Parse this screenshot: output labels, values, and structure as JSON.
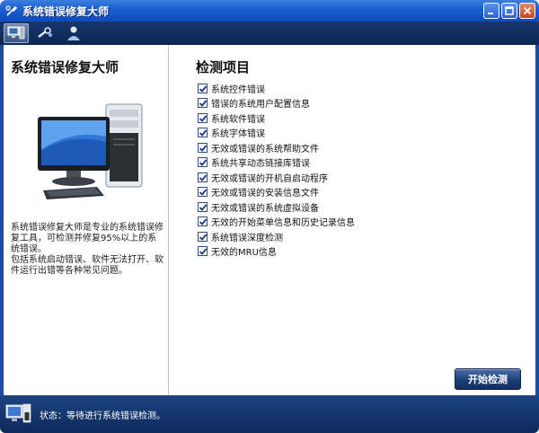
{
  "window": {
    "title": "系统错误修复大师"
  },
  "left_panel": {
    "title": "系统错误修复大师",
    "description_line1": "系统错误修复大师是专业的系统错误修复工具，可检测并修复95%以上的系统错误。",
    "description_line2": "包括系统启动错误、软件无法打开、软件运行出错等各种常见问题。"
  },
  "right_panel": {
    "title": "检测项目",
    "items": [
      {
        "label": "系统控件错误",
        "checked": true
      },
      {
        "label": "错误的系统用户配置信息",
        "checked": true
      },
      {
        "label": "系统软件错误",
        "checked": true
      },
      {
        "label": "系统字体错误",
        "checked": true
      },
      {
        "label": "无效或错误的系统帮助文件",
        "checked": true
      },
      {
        "label": "系统共享动态链接库错误",
        "checked": true
      },
      {
        "label": "无效或错误的开机自启动程序",
        "checked": true
      },
      {
        "label": "无效或错误的安装信息文件",
        "checked": true
      },
      {
        "label": "无效或错误的系统虚拟设备",
        "checked": true
      },
      {
        "label": "无效的开始菜单信息和历史记录信息",
        "checked": true
      },
      {
        "label": "系统错误深度检测",
        "checked": true
      },
      {
        "label": "无效的MRU信息",
        "checked": true
      }
    ],
    "start_button": "开始检测"
  },
  "status": {
    "text": "状态：等待进行系统错误检测。"
  },
  "colors": {
    "title_bar": "#1d5fd0",
    "toolbar": "#0c2652",
    "status_bar": "#0e2a5c",
    "button": "#1d3f78"
  }
}
